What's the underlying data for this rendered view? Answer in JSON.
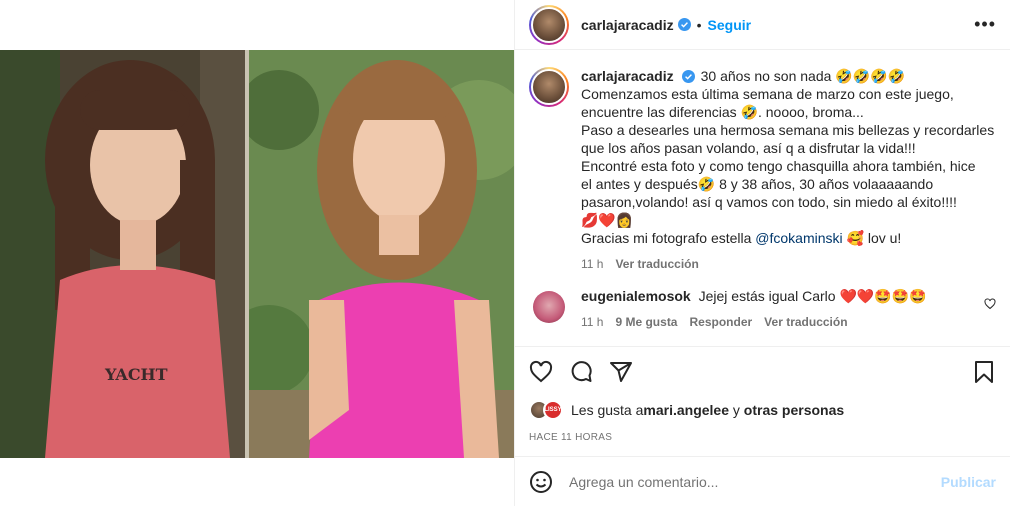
{
  "post": {
    "author": "carlajaracadiz",
    "follow_label": "Seguir",
    "dot": "•",
    "more_label": "•••",
    "caption_lines": [
      "30 años no son nada 🤣🤣🤣🤣",
      "Comenzamos esta última semana de marzo con este juego,",
      "encuentre las diferencias 🤣. noooo, broma...",
      "Paso a desearles una hermosa semana mis bellezas y recordarles",
      "que los años pasan volando, así q a disfrutar la vida!!!",
      "Encontré esta foto y como tengo chasquilla ahora también, hice",
      "el antes y después🤣 8 y 38 años, 30 años volaaaaando",
      "pasaron,volando! así q vamos con todo, sin miedo al éxito!!!!",
      "💋❤️👩"
    ],
    "caption_last_prefix": "Gracias mi fotografo estella ",
    "caption_mention": "@fcokaminski",
    "caption_last_suffix": " 🥰 lov u!",
    "caption_time": "11 h",
    "caption_translate": "Ver traducción"
  },
  "comment": {
    "author": "eugenialemosok",
    "text": "Jejej estás igual Carlo ❤️❤️🤩🤩🤩",
    "time": "11 h",
    "likes": "9 Me gusta",
    "reply": "Responder",
    "translate": "Ver traducción"
  },
  "likes": {
    "prefix": "Les gusta a ",
    "user": "mari.angelee",
    "middle": " y ",
    "others": "otras personas",
    "badge": "LISSY"
  },
  "time_ago": "HACE 11 HORAS",
  "add_comment": {
    "placeholder": "Agrega un comentario...",
    "publish": "Publicar"
  },
  "colors": {
    "accent_blue": "#0095f6",
    "publish_disabled": "#b3dbff",
    "verified": "#3897f0",
    "like_heart": "#262626"
  },
  "icons": [
    "heart-icon",
    "comment-icon",
    "share-icon",
    "bookmark-icon",
    "smile-icon",
    "verified-icon",
    "more-icon"
  ]
}
